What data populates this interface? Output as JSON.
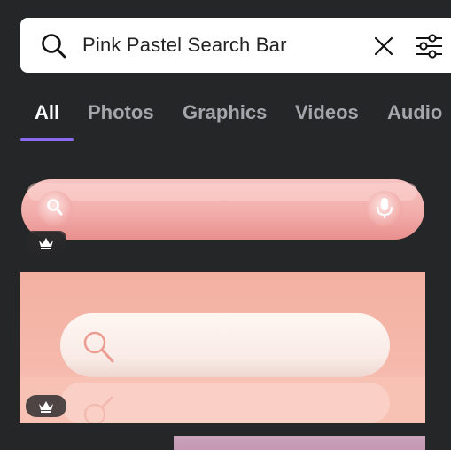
{
  "search": {
    "query": "Pink Pastel Search Bar",
    "icon": "search-icon",
    "clear_icon": "close-icon",
    "filter_icon": "filter-sliders-icon"
  },
  "tabs": [
    {
      "label": "All",
      "active": true
    },
    {
      "label": "Photos",
      "active": false
    },
    {
      "label": "Graphics",
      "active": false
    },
    {
      "label": "Videos",
      "active": false
    },
    {
      "label": "Audio",
      "active": false
    }
  ],
  "results": [
    {
      "kind": "pink search bar graphic",
      "premium_badge": "crown-icon"
    },
    {
      "kind": "white search bar on pink photo",
      "premium_badge": "crown-icon"
    },
    {
      "kind": "mauve image preview"
    }
  ],
  "colors": {
    "background": "#252627",
    "accent": "#8b6cf0",
    "tab_inactive": "#a3a6ab",
    "pink": "#f2b3b0",
    "mauve": "#c8a0b8"
  }
}
